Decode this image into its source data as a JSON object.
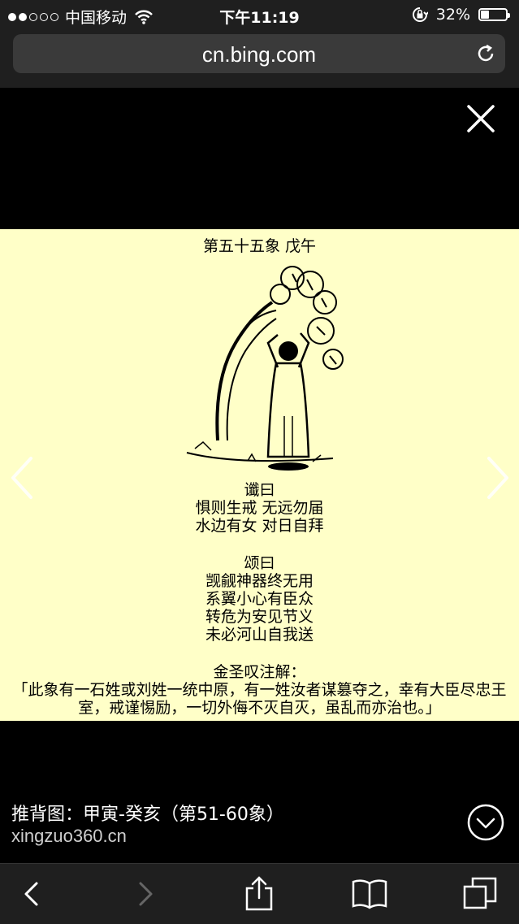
{
  "status_bar": {
    "carrier": "中国移动",
    "time": "下午11:19",
    "battery_percent": "32%",
    "battery_level": 0.32,
    "signal_bars": 2
  },
  "browser": {
    "url": "cn.bing.com"
  },
  "image": {
    "title": "第五十五象 戊午",
    "prophecy_heading": "谶曰",
    "prophecy_lines": [
      "惧则生戒 无远勿届",
      "水边有女 对日自拜"
    ],
    "verse_heading": "颂曰",
    "verse_lines": [
      "觊觎神器终无用",
      "系翼小心有臣众",
      "转危为安见节义",
      "未必河山自我送"
    ],
    "commentary_heading": "金圣叹注解：",
    "commentary_lines": [
      "「此象有一石姓或刘姓一统中原，有一姓汝者谋篡夺之，幸有大臣尽忠王",
      "室，戒谨惕励，一切外侮不灭自灭，虽乱而亦治也。」"
    ]
  },
  "caption": {
    "title": "推背图：甲寅-癸亥（第51-60象）",
    "source": "xingzuo360.cn"
  },
  "colors": {
    "image_background": "#ffffc8",
    "bar_background": "#1f1f1f"
  }
}
